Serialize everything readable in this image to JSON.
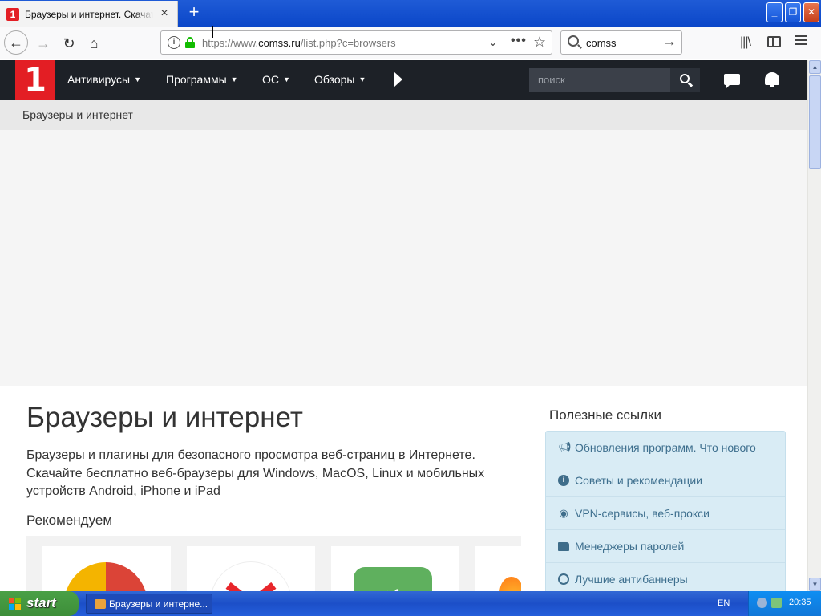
{
  "browser": {
    "tab_title": "Браузеры и интернет. Скачать бесплатно",
    "favicon_glyph": "1",
    "new_tab_glyph": "+",
    "url_prefix": "https://www.",
    "url_host": "comss.ru",
    "url_path": "/list.php?c=browsers",
    "search_value": "comss",
    "window_controls": [
      "minimize",
      "maximize",
      "close"
    ]
  },
  "site": {
    "logo_glyph": "1",
    "menu": [
      {
        "label": "Антивирусы"
      },
      {
        "label": "Программы"
      },
      {
        "label": "ОС"
      },
      {
        "label": "Обзоры"
      }
    ],
    "search_placeholder": "поиск",
    "breadcrumb": "Браузеры и интернет"
  },
  "main": {
    "title": "Браузеры и интернет",
    "description": "Браузеры и плагины для безопасного просмотра веб-страниц в Интернете. Скачайте бесплатно веб-браузеры для Windows, MacOS, Linux и мобильных устройств Android, iPhone и iPad",
    "recommend_heading": "Рекомендуем"
  },
  "sidebar": {
    "title": "Полезные ссылки",
    "links": [
      {
        "label": "Обновления программ. Что нового",
        "icon": "megaphone-icon"
      },
      {
        "label": "Советы и рекомендации",
        "icon": "info-icon"
      },
      {
        "label": "VPN-сервисы, веб-прокси",
        "icon": "eye-slash-icon"
      },
      {
        "label": "Менеджеры паролей",
        "icon": "folder-icon"
      },
      {
        "label": "Лучшие антибаннеры",
        "icon": "power-icon"
      }
    ]
  },
  "taskbar": {
    "start_label": "start",
    "task_label": "Браузеры и интерне...",
    "language": "EN",
    "clock": "20:35"
  },
  "colors": {
    "brand_red": "#e31e24",
    "header_dark": "#1d2127",
    "links_panel": "#d9ecf5",
    "xp_blue": "#245edb"
  }
}
